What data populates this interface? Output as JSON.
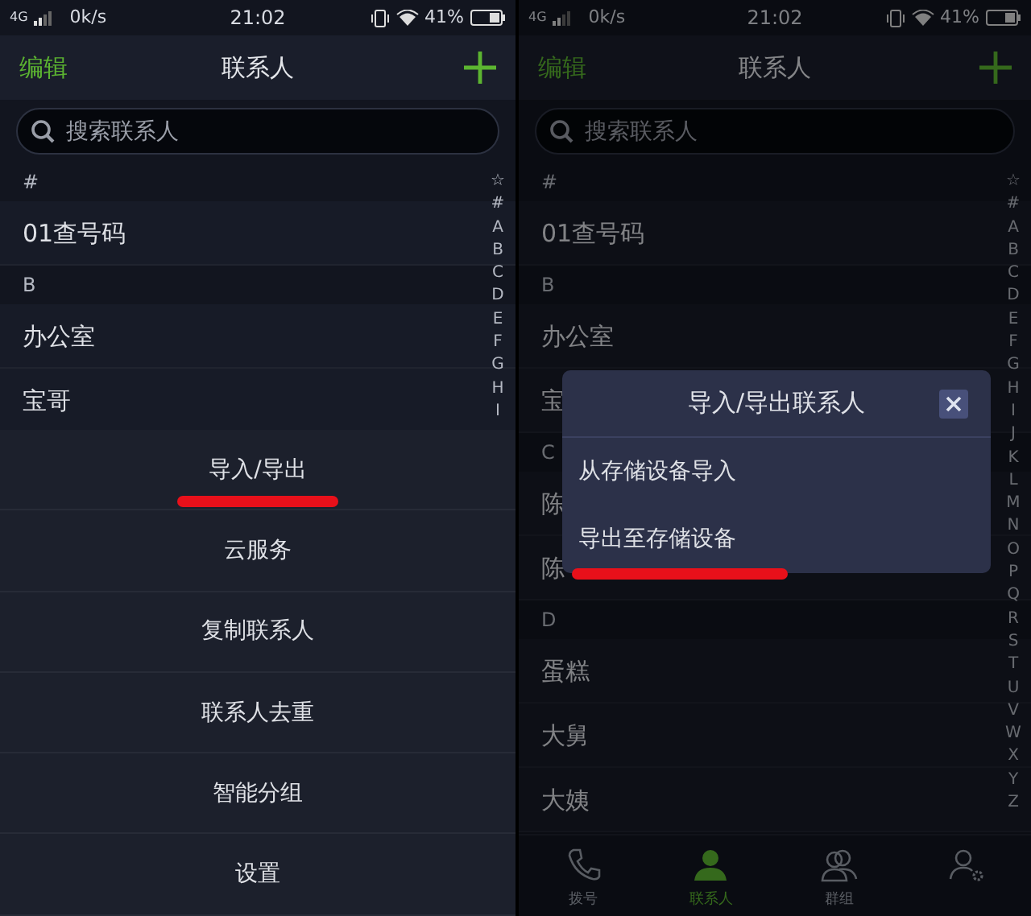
{
  "panels": [
    {
      "status_bar": {
        "network": "4G",
        "speed": "0k/s",
        "time": "21:02",
        "battery": "41%"
      },
      "header": {
        "edit": "编辑",
        "title": "联系人"
      },
      "search": {
        "placeholder": "搜索联系人"
      },
      "contacts": [
        {
          "kind": "section",
          "label": "#"
        },
        {
          "kind": "contact",
          "label": "01查号码"
        },
        {
          "kind": "section",
          "label": "B"
        },
        {
          "kind": "contact",
          "label": "办公室"
        },
        {
          "kind": "contact",
          "label": "宝哥"
        }
      ],
      "index_bar": [
        "☆",
        "#",
        "A",
        "B",
        "C",
        "D",
        "E",
        "F",
        "G",
        "H",
        "I"
      ],
      "menu": [
        {
          "label": "导入/导出",
          "underlined": true
        },
        {
          "label": "云服务",
          "underlined": false
        },
        {
          "label": "复制联系人",
          "underlined": false
        },
        {
          "label": "联系人去重",
          "underlined": false
        },
        {
          "label": "智能分组",
          "underlined": false
        },
        {
          "label": "设置",
          "underlined": false
        }
      ]
    },
    {
      "dimmed": true,
      "status_bar": {
        "network": "4G",
        "speed": "0k/s",
        "time": "21:02",
        "battery": "41%"
      },
      "header": {
        "edit": "编辑",
        "title": "联系人"
      },
      "search": {
        "placeholder": "搜索联系人"
      },
      "contacts": [
        {
          "kind": "section",
          "label": "#"
        },
        {
          "kind": "contact",
          "label": "01查号码"
        },
        {
          "kind": "section",
          "label": "B"
        },
        {
          "kind": "contact",
          "label": "办公室"
        },
        {
          "kind": "contact",
          "label": "宝"
        },
        {
          "kind": "section",
          "label": "C"
        },
        {
          "kind": "contact",
          "label": "陈"
        },
        {
          "kind": "contact",
          "label": "陈"
        },
        {
          "kind": "section",
          "label": "D"
        },
        {
          "kind": "contact",
          "label": "蛋糕"
        },
        {
          "kind": "contact",
          "label": "大舅"
        },
        {
          "kind": "contact",
          "label": "大姨"
        }
      ],
      "index_bar": [
        "☆",
        "#",
        "A",
        "B",
        "C",
        "D",
        "E",
        "F",
        "G",
        "H",
        "I",
        "J",
        "K",
        "L",
        "M",
        "N",
        "O",
        "P",
        "Q",
        "R",
        "S",
        "T",
        "U",
        "V",
        "W",
        "X",
        "Y",
        "Z"
      ],
      "dialog": {
        "title": "导入/导出联系人",
        "options": [
          {
            "label": "从存储设备导入",
            "underlined": false
          },
          {
            "label": "导出至存储设备",
            "underlined": true
          }
        ]
      },
      "tab_bar": [
        {
          "kind": "phone",
          "label": "拨号",
          "selected": false
        },
        {
          "kind": "contact",
          "label": "联系人",
          "selected": true
        },
        {
          "kind": "group",
          "label": "群组",
          "selected": false
        },
        {
          "kind": "settings",
          "selected": false
        }
      ]
    }
  ]
}
